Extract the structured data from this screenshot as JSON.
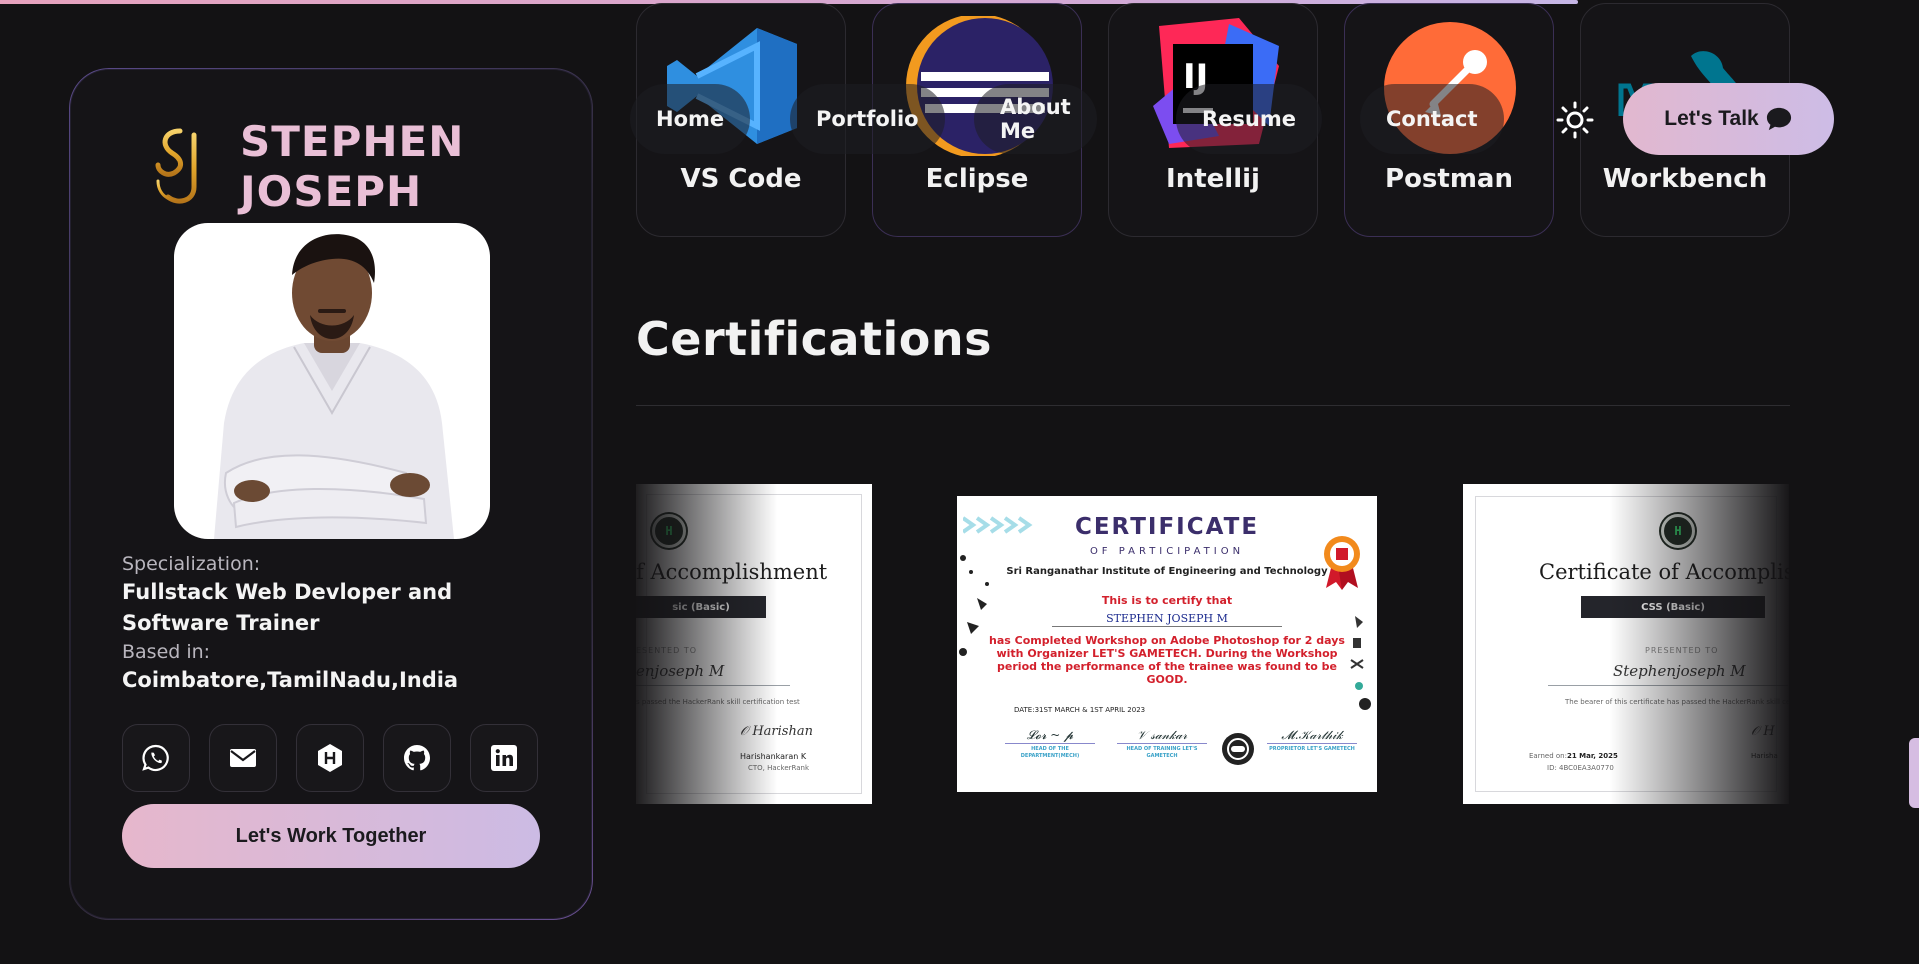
{
  "profile": {
    "name_line1": "STEPHEN",
    "name_line2": "JOSEPH",
    "specialization_label": "Specialization:",
    "specialization_value": "Fullstack Web Devloper and Software Trainer",
    "based_label": "Based in:",
    "based_value": "Coimbatore,TamilNadu,India",
    "cta_label": "Let's Work Together",
    "socials": [
      "whatsapp-icon",
      "mail-icon",
      "hackerrank-icon",
      "github-icon",
      "linkedin-icon"
    ]
  },
  "tools": [
    {
      "name": "VS Code",
      "icon": "vscode-icon"
    },
    {
      "name": "Eclipse",
      "icon": "eclipse-icon"
    },
    {
      "name": "Intellij",
      "icon": "intellij-icon"
    },
    {
      "name": "Postman",
      "icon": "postman-icon"
    },
    {
      "name": "Workbench",
      "icon": "mysql-workbench-icon"
    }
  ],
  "nav": {
    "items": [
      "Home",
      "Portfolio",
      "About Me",
      "Resume",
      "Contact"
    ],
    "talk_label": "Let's Talk",
    "theme_icon": "sun-icon"
  },
  "certifications": {
    "title": "Certifications",
    "left": {
      "title": "f Accomplishment",
      "ribbon": "sic (Basic)",
      "presented": "ESENTED TO",
      "name": "enjoseph M",
      "desc": "s passed the HackerRank skill certification test",
      "signer": "Harishankaran K",
      "signer_title": "CTO, HackerRank",
      "badge": "H"
    },
    "middle": {
      "heading": "CERTIFICATE",
      "sub": "OF PARTICIPATION",
      "institute": "Sri Ranganathar Institute of Engineering and Technology",
      "certify": "This is to certify that",
      "name": "STEPHEN JOSEPH  M",
      "body": "has Completed Workshop on Adobe Photoshop for 2 days with Organizer LET'S GAMETECH. During the Workshop period the performance of the trainee was found to be GOOD.",
      "date": "DATE:31ST MARCH & 1ST APRIL 2023",
      "sig1_title": "HEAD OF THE DEPARTMENT(MECH)",
      "sig2_title": "HEAD OF TRAINING LET'S GAMETECH",
      "sig3_title": "PROPRIETOR LET'S GAMETECH"
    },
    "right": {
      "title": "Certificate of Accomplishme",
      "ribbon": "CSS (Basic)",
      "presented": "PRESENTED TO",
      "name": "Stephenjoseph M",
      "desc": "The bearer of this certificate has passed the HackerRank skill certification",
      "earned_label": "Earned on:",
      "earned_value": "21 Mar, 2025",
      "cert_id": "ID: 4BC0EA3A0770",
      "signer": "Harisha",
      "badge": "H"
    }
  },
  "colors": {
    "background": "#131214",
    "accent_pink": "#e9bfd6",
    "accent_lilac": "#ccbbe4"
  }
}
